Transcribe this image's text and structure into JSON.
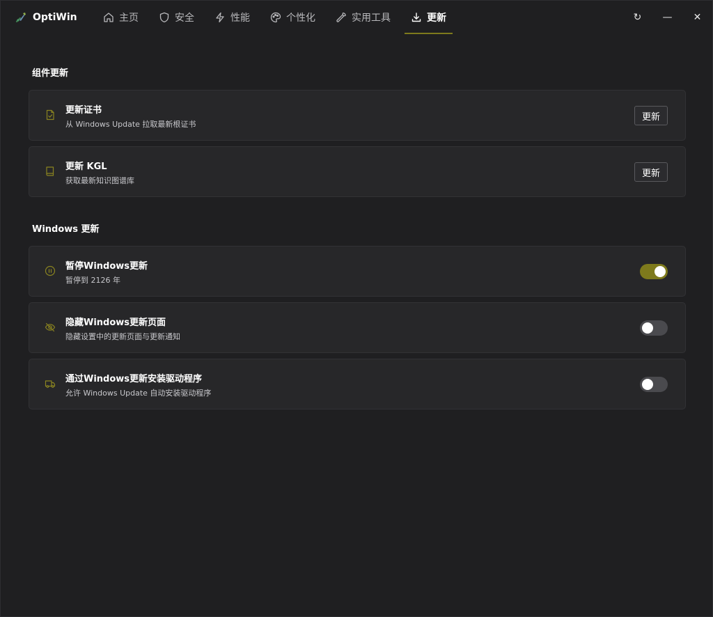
{
  "app": {
    "name": "OptiWin"
  },
  "colors": {
    "accent": "#7e7a1c",
    "background": "#1f1f21",
    "card": "#272729"
  },
  "nav": {
    "items": [
      {
        "label": "主页",
        "icon": "home-icon",
        "active": false
      },
      {
        "label": "安全",
        "icon": "shield-icon",
        "active": false
      },
      {
        "label": "性能",
        "icon": "lightning-icon",
        "active": false
      },
      {
        "label": "个性化",
        "icon": "palette-icon",
        "active": false
      },
      {
        "label": "实用工具",
        "icon": "wrench-icon",
        "active": false
      },
      {
        "label": "更新",
        "icon": "download-icon",
        "active": true
      }
    ]
  },
  "window_controls": {
    "refresh": "↻",
    "minimize": "—",
    "close": "✕"
  },
  "sections": {
    "components": {
      "title": "组件更新",
      "items": [
        {
          "title": "更新证书",
          "desc": "从 Windows Update 拉取最新根证书",
          "icon": "certificate-file-icon",
          "button": "更新"
        },
        {
          "title": "更新 KGL",
          "desc": "获取最新知识图谱库",
          "icon": "book-icon",
          "button": "更新"
        }
      ]
    },
    "windows": {
      "title": "Windows 更新",
      "items": [
        {
          "title": "暂停Windows更新",
          "desc": "暂停到 2126 年",
          "icon": "pause-circle-icon",
          "enabled": true
        },
        {
          "title": "隐藏Windows更新页面",
          "desc": "隐藏设置中的更新页面与更新通知",
          "icon": "eye-off-icon",
          "enabled": false
        },
        {
          "title": "通过Windows更新安装驱动程序",
          "desc": "允许 Windows Update 自动安装驱动程序",
          "icon": "truck-icon",
          "enabled": false
        }
      ]
    }
  }
}
